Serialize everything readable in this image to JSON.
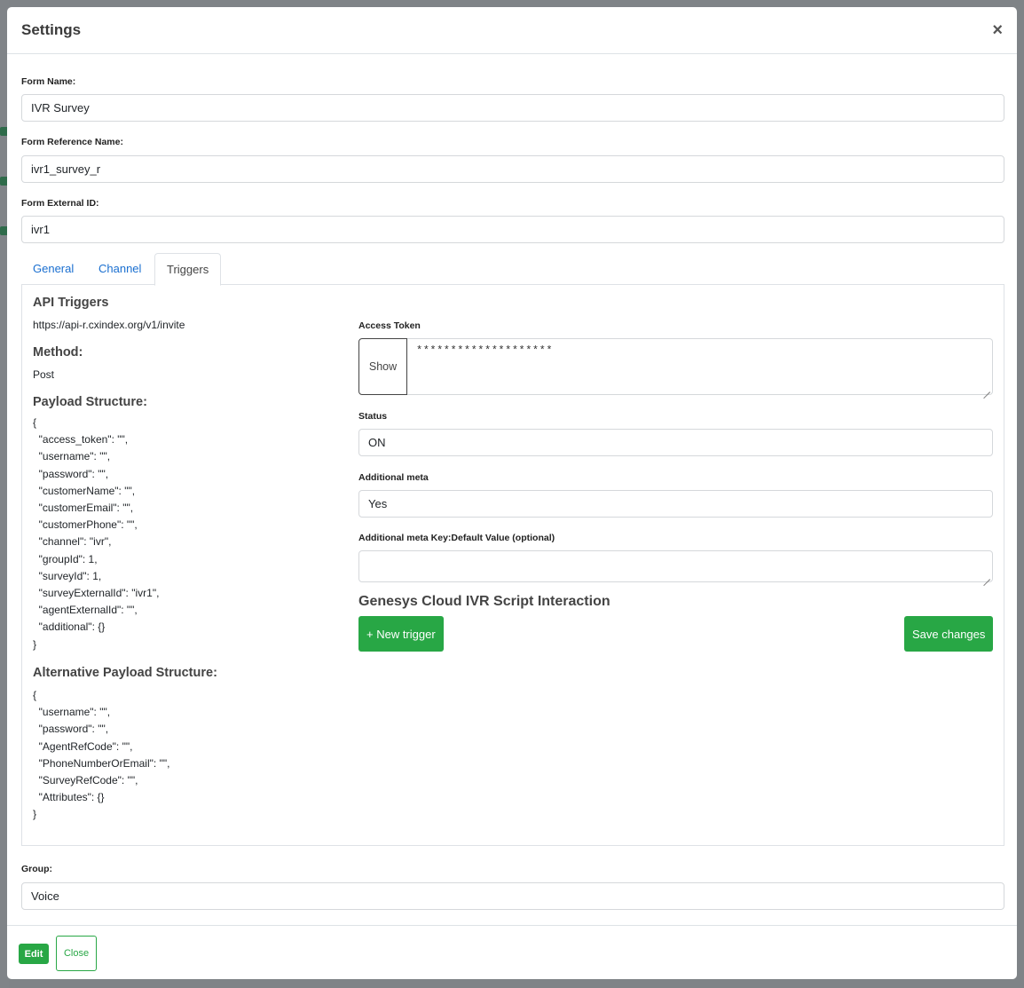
{
  "modal": {
    "title": "Settings",
    "close_icon": "×"
  },
  "form": {
    "name_label": "Form Name:",
    "name_value": "IVR Survey",
    "ref_label": "Form Reference Name:",
    "ref_value": "ivr1_survey_r",
    "ext_label": "Form External ID:",
    "ext_value": "ivr1"
  },
  "tabs": [
    {
      "label": "General"
    },
    {
      "label": "Channel"
    },
    {
      "label": "Triggers",
      "active": true
    }
  ],
  "triggers": {
    "api_heading": "API Triggers",
    "api_url": "https://api-r.cxindex.org/v1/invite",
    "method_heading": "Method:",
    "method_value": "Post",
    "payload_heading": "Payload Structure:",
    "payload_lines": [
      "{",
      "  \"access_token\": \"\",",
      "  \"username\": \"\",",
      "  \"password\": \"\",",
      "  \"customerName\": \"\",",
      "  \"customerEmail\": \"\",",
      "  \"customerPhone\": \"\",",
      "  \"channel\": \"ivr\",",
      "  \"groupId\": 1,",
      "  \"surveyId\": 1,",
      "  \"surveyExternalId\": \"ivr1\",",
      "  \"agentExternalId\": \"\",",
      "  \"additional\": {}",
      "}"
    ],
    "alt_heading": "Alternative Payload Structure:",
    "alt_lines": [
      "{",
      "  \"username\": \"\",",
      "  \"password\": \"\",",
      "  \"AgentRefCode\": \"\",",
      "  \"PhoneNumberOrEmail\": \"\",",
      "  \"SurveyRefCode\": \"\",",
      "  \"Attributes\": {}",
      "}"
    ],
    "access_token_label": "Access Token",
    "show_label": "Show",
    "access_token_value": "********************",
    "status_label": "Status",
    "status_value": "ON",
    "meta_label": "Additional meta",
    "meta_value": "Yes",
    "meta_kv_label": "Additional meta Key:Default Value (optional)",
    "meta_kv_value": "",
    "genesys_heading": "Genesys Cloud IVR Script Interaction",
    "new_trigger_label": "+ New trigger",
    "save_label": "Save changes"
  },
  "group": {
    "label": "Group:",
    "value": "Voice"
  },
  "footer": {
    "edit_label": "Edit",
    "close_label": "Close"
  },
  "colors": {
    "accent_green": "#28a745",
    "link_blue": "#1a6fd0",
    "backdrop": "#7f8387"
  }
}
